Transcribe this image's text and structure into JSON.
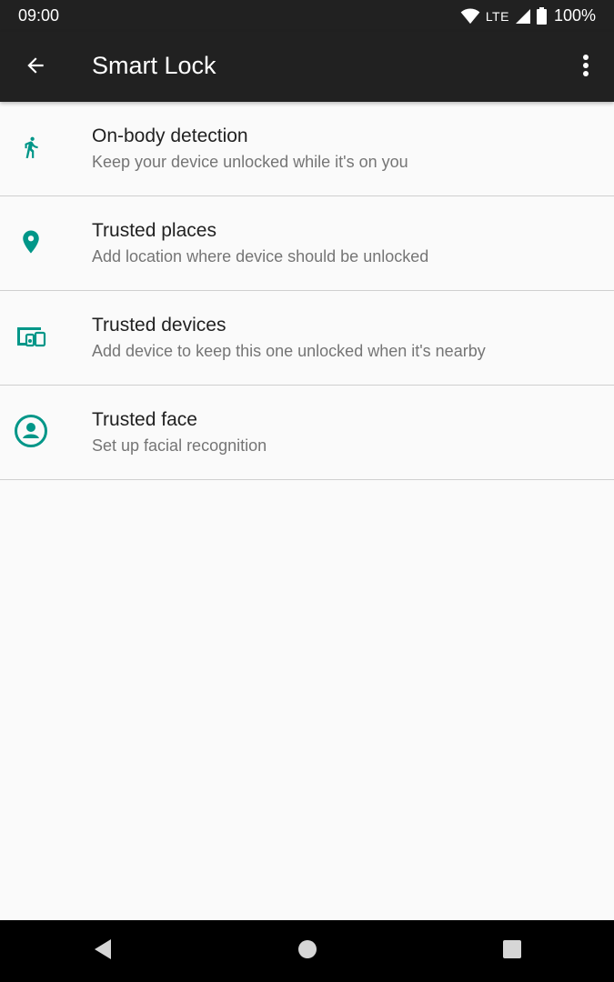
{
  "status_bar": {
    "time": "09:00",
    "network": "LTE",
    "battery": "100%",
    "icons": [
      "wifi-icon",
      "cell-signal-icon",
      "battery-icon"
    ]
  },
  "toolbar": {
    "title": "Smart Lock",
    "back_icon": "arrow-back-icon",
    "menu_icon": "more-vert-icon"
  },
  "accent_color": "#009688",
  "items": [
    {
      "title": "On-body detection",
      "subtitle": "Keep your device unlocked while it's on you",
      "icon": "walking-person-icon"
    },
    {
      "title": "Trusted places",
      "subtitle": "Add location where device should be unlocked",
      "icon": "location-pin-icon"
    },
    {
      "title": "Trusted devices",
      "subtitle": "Add device to keep this one unlocked when it's nearby",
      "icon": "devices-icon"
    },
    {
      "title": "Trusted face",
      "subtitle": "Set up facial recognition",
      "icon": "face-icon"
    }
  ],
  "nav_bar": {
    "icons": [
      "nav-back-icon",
      "nav-home-icon",
      "nav-recents-icon"
    ]
  }
}
